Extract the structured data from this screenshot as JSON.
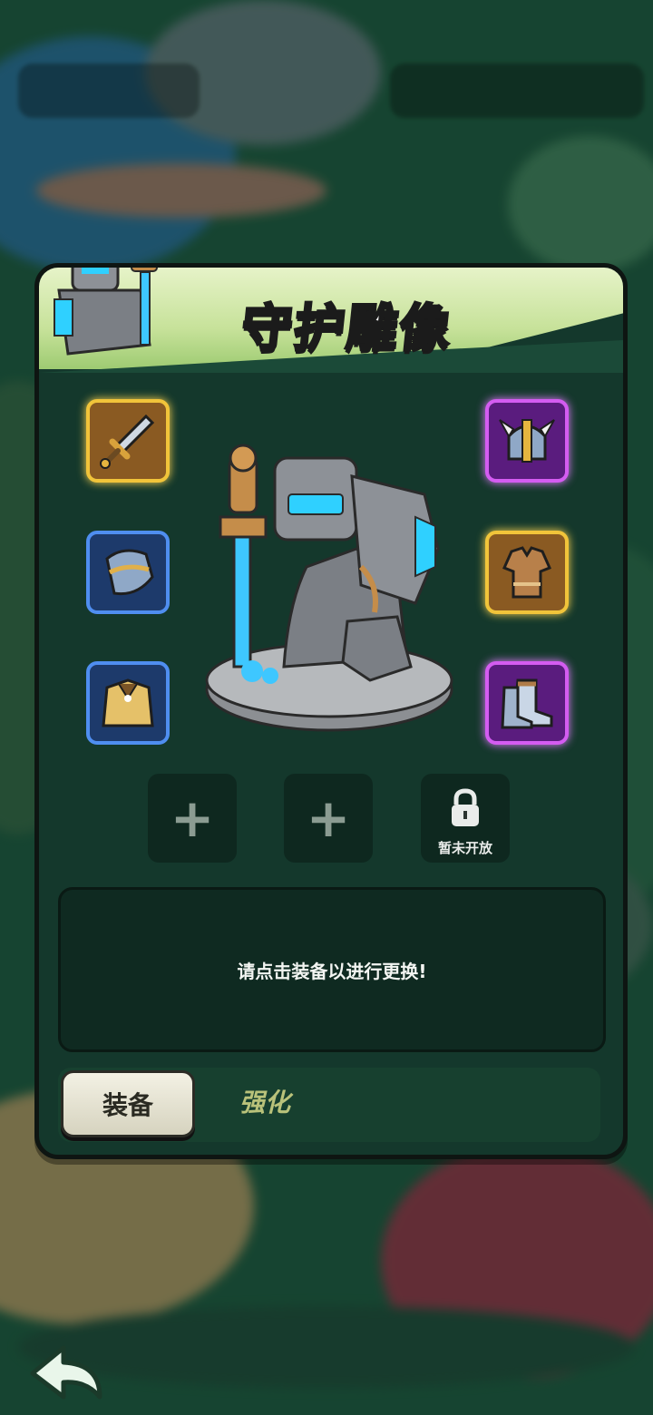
{
  "panel": {
    "title": "守护雕像",
    "icon": "guardian-statue-icon"
  },
  "slots": [
    {
      "name": "sword",
      "icon": "sword-icon",
      "rarity": "gold"
    },
    {
      "name": "helmet",
      "icon": "horned-helmet-icon",
      "rarity": "purple"
    },
    {
      "name": "shoulder",
      "icon": "shoulder-armor-icon",
      "rarity": "blue"
    },
    {
      "name": "chest",
      "icon": "chest-armor-icon",
      "rarity": "gold"
    },
    {
      "name": "cape",
      "icon": "cape-icon",
      "rarity": "blue"
    },
    {
      "name": "boots",
      "icon": "boots-icon",
      "rarity": "purple"
    }
  ],
  "extra_slots": {
    "add_icon": "plus-icon",
    "locked_label": "暂未开放",
    "lock_icon": "lock-icon"
  },
  "info": {
    "message": "请点击装备以进行更换!"
  },
  "tabs": {
    "equip": "装备",
    "enhance": "强化"
  },
  "back_icon": "back-arrow-icon"
}
